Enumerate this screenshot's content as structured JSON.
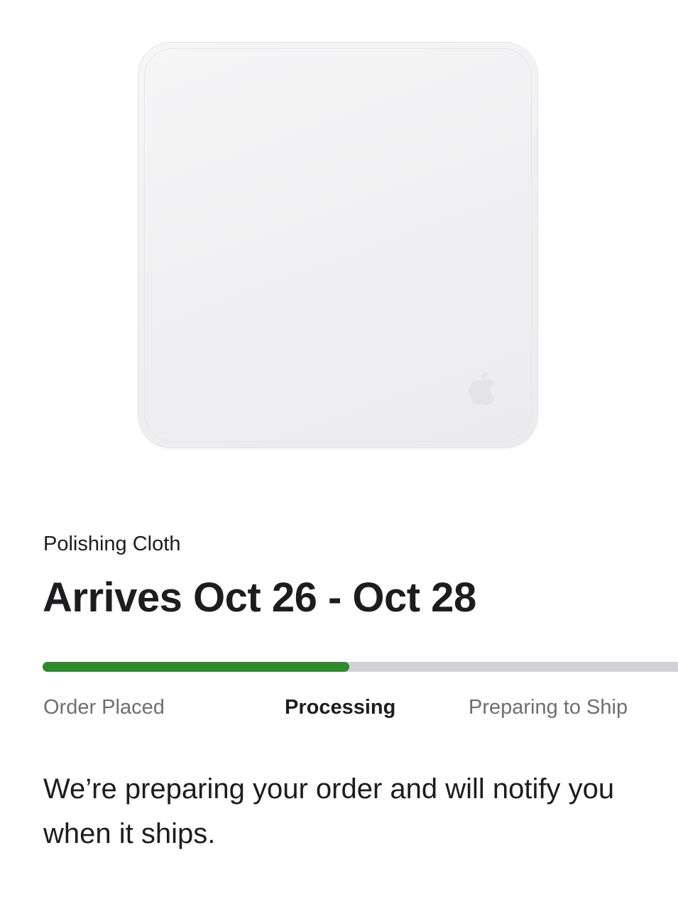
{
  "product": {
    "image_icon": "polishing-cloth-image",
    "logo_icon": "apple-logo-icon",
    "name": "Polishing Cloth"
  },
  "delivery": {
    "arrival_text": "Arrives Oct 26 - Oct 28"
  },
  "progress": {
    "fraction": 0.483,
    "fill_color": "#2f8a2e",
    "track_color": "#d2d2d4",
    "steps": [
      {
        "label": "Order Placed",
        "active": false
      },
      {
        "label": "Processing",
        "active": true
      },
      {
        "label": "Preparing to Ship",
        "active": false
      }
    ]
  },
  "status": {
    "message": "We’re preparing your order and will notify you when it ships."
  }
}
